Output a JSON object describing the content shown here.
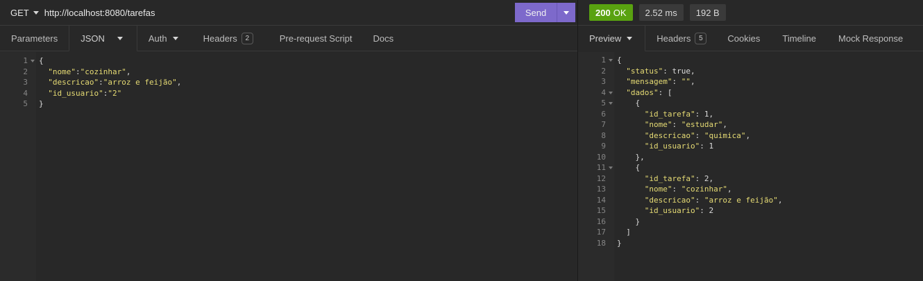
{
  "request": {
    "method": "GET",
    "url": "http://localhost:8080/tarefas",
    "send_label": "Send"
  },
  "request_tabs": [
    {
      "label": "Parameters"
    },
    {
      "label": "JSON"
    },
    {
      "label": "Auth"
    },
    {
      "label": "Headers",
      "count": "2"
    },
    {
      "label": "Pre-request Script"
    },
    {
      "label": "Docs"
    }
  ],
  "request_body": {
    "line_numbers": [
      "1",
      "2",
      "3",
      "4",
      "5"
    ],
    "lines": [
      "{",
      "  \"nome\":\"cozinhar\",",
      "  \"descricao\":\"arroz e feijão\",",
      "  \"id_usuario\":\"2\"",
      "}"
    ]
  },
  "response": {
    "status_code": "200",
    "status_text": "OK",
    "time": "2.52 ms",
    "size": "192 B"
  },
  "response_tabs": [
    {
      "label": "Preview"
    },
    {
      "label": "Headers",
      "count": "5"
    },
    {
      "label": "Cookies"
    },
    {
      "label": "Timeline"
    },
    {
      "label": "Mock Response"
    }
  ],
  "response_body": {
    "line_numbers": [
      "1",
      "2",
      "3",
      "4",
      "5",
      "6",
      "7",
      "8",
      "9",
      "10",
      "11",
      "12",
      "13",
      "14",
      "15",
      "16",
      "17",
      "18"
    ],
    "lines": [
      "{",
      "  \"status\": true,",
      "  \"mensagem\": \"\",",
      "  \"dados\": [",
      "    {",
      "      \"id_tarefa\": 1,",
      "      \"nome\": \"estudar\",",
      "      \"descricao\": \"quimica\",",
      "      \"id_usuario\": 1",
      "    },",
      "    {",
      "      \"id_tarefa\": 2,",
      "      \"nome\": \"cozinhar\",",
      "      \"descricao\": \"arroz e feijão\",",
      "      \"id_usuario\": 2",
      "    }",
      "  ]",
      "}"
    ],
    "foldable_lines": [
      "1",
      "4",
      "5",
      "11"
    ]
  },
  "colors": {
    "accent": "#7d69cb",
    "status_ok": "#59a210",
    "background": "#282828",
    "string": "#e6db74"
  },
  "icons": {
    "method_dropdown": "caret-down-icon",
    "send_options": "caret-down-icon",
    "fold_marker": "fold-caret-icon"
  }
}
